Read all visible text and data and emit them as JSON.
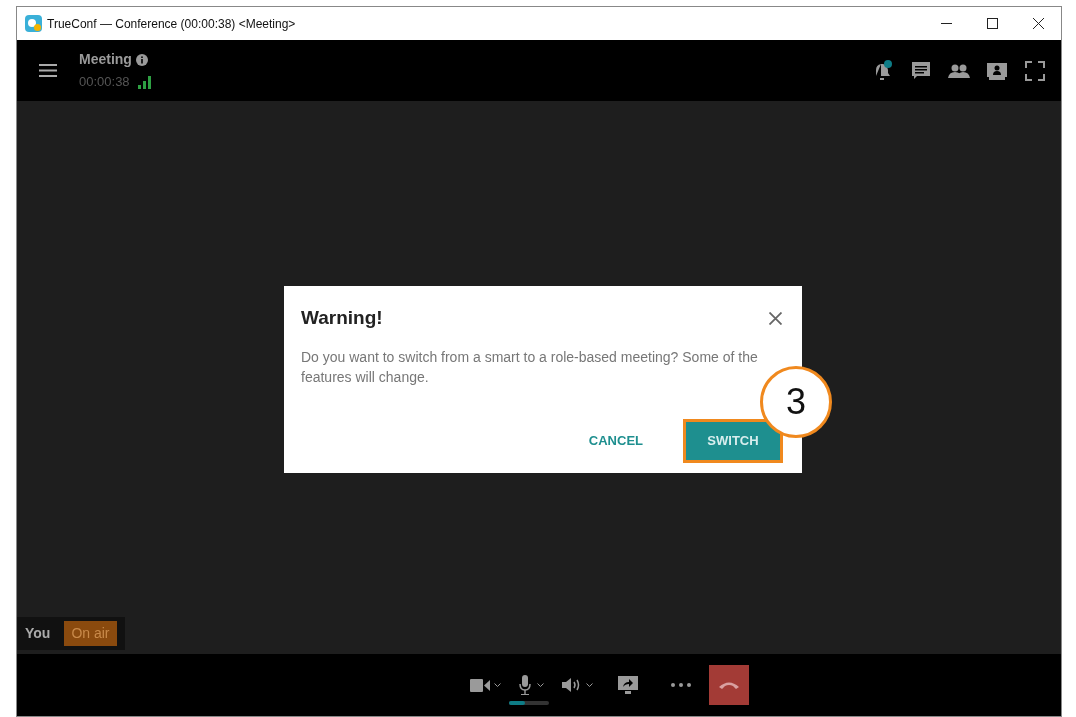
{
  "window": {
    "title": "TrueConf — Conference (00:00:38) <Meeting>"
  },
  "header": {
    "title": "Meeting",
    "timer": "00:00:38"
  },
  "self_view": {
    "name": "You",
    "status": "On air"
  },
  "toolbar": {
    "microphone": {
      "level": 0.4
    }
  },
  "dialog": {
    "title": "Warning!",
    "message": "Do you want to switch from a smart to a role-based meeting? Some of the features will change.",
    "buttons": [
      {
        "label": "CANCEL",
        "kind": "text"
      },
      {
        "label": "SWITCH",
        "kind": "primary"
      }
    ]
  },
  "callout": {
    "label": "3"
  }
}
